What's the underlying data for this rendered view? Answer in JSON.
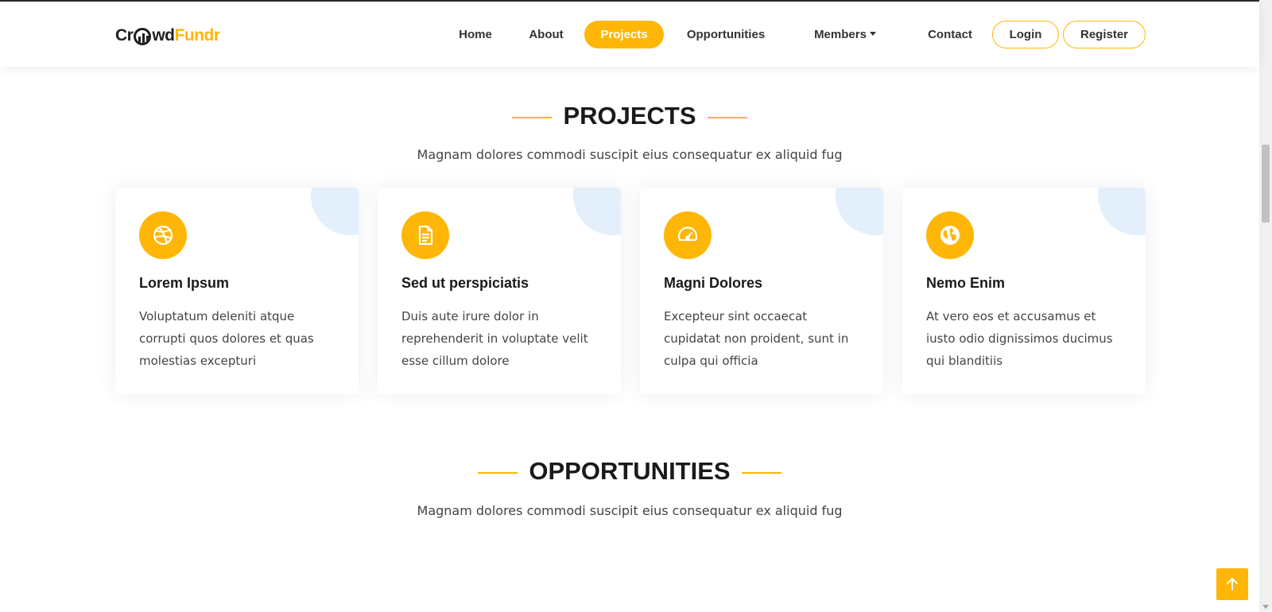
{
  "header": {
    "logo": {
      "part1": "Cr",
      "part2": "wd",
      "part3": "Fundr"
    },
    "nav": [
      {
        "label": "Home"
      },
      {
        "label": "About"
      },
      {
        "label": "Projects",
        "active": true
      },
      {
        "label": "Opportunities"
      },
      {
        "label": "Members"
      },
      {
        "label": "Contact"
      },
      {
        "label": "Login"
      },
      {
        "label": "Register"
      }
    ]
  },
  "projects": {
    "title": "PROJECTS",
    "subtitle": "Magnam dolores commodi suscipit eius consequatur ex aliquid fug",
    "cards": [
      {
        "icon": "dribbble-icon",
        "title": "Lorem Ipsum",
        "text": "Voluptatum deleniti atque corrupti quos dolores et quas molestias excepturi"
      },
      {
        "icon": "file-text-icon",
        "title": "Sed ut perspiciatis",
        "text": "Duis aute irure dolor in reprehenderit in voluptate velit esse cillum dolore"
      },
      {
        "icon": "speedometer-icon",
        "title": "Magni Dolores",
        "text": "Excepteur sint occaecat cupidatat non proident, sunt in culpa qui officia"
      },
      {
        "icon": "globe-icon",
        "title": "Nemo Enim",
        "text": "At vero eos et accusamus et iusto odio dignissimos ducimus qui blanditiis"
      }
    ]
  },
  "opportunities": {
    "title": "OPPORTUNITIES",
    "subtitle": "Magnam dolores commodi suscipit eius consequatur ex aliquid fug"
  },
  "colors": {
    "accent": "#ffb606",
    "corner": "#e3f0fb",
    "heading": "#1a1a1a"
  }
}
